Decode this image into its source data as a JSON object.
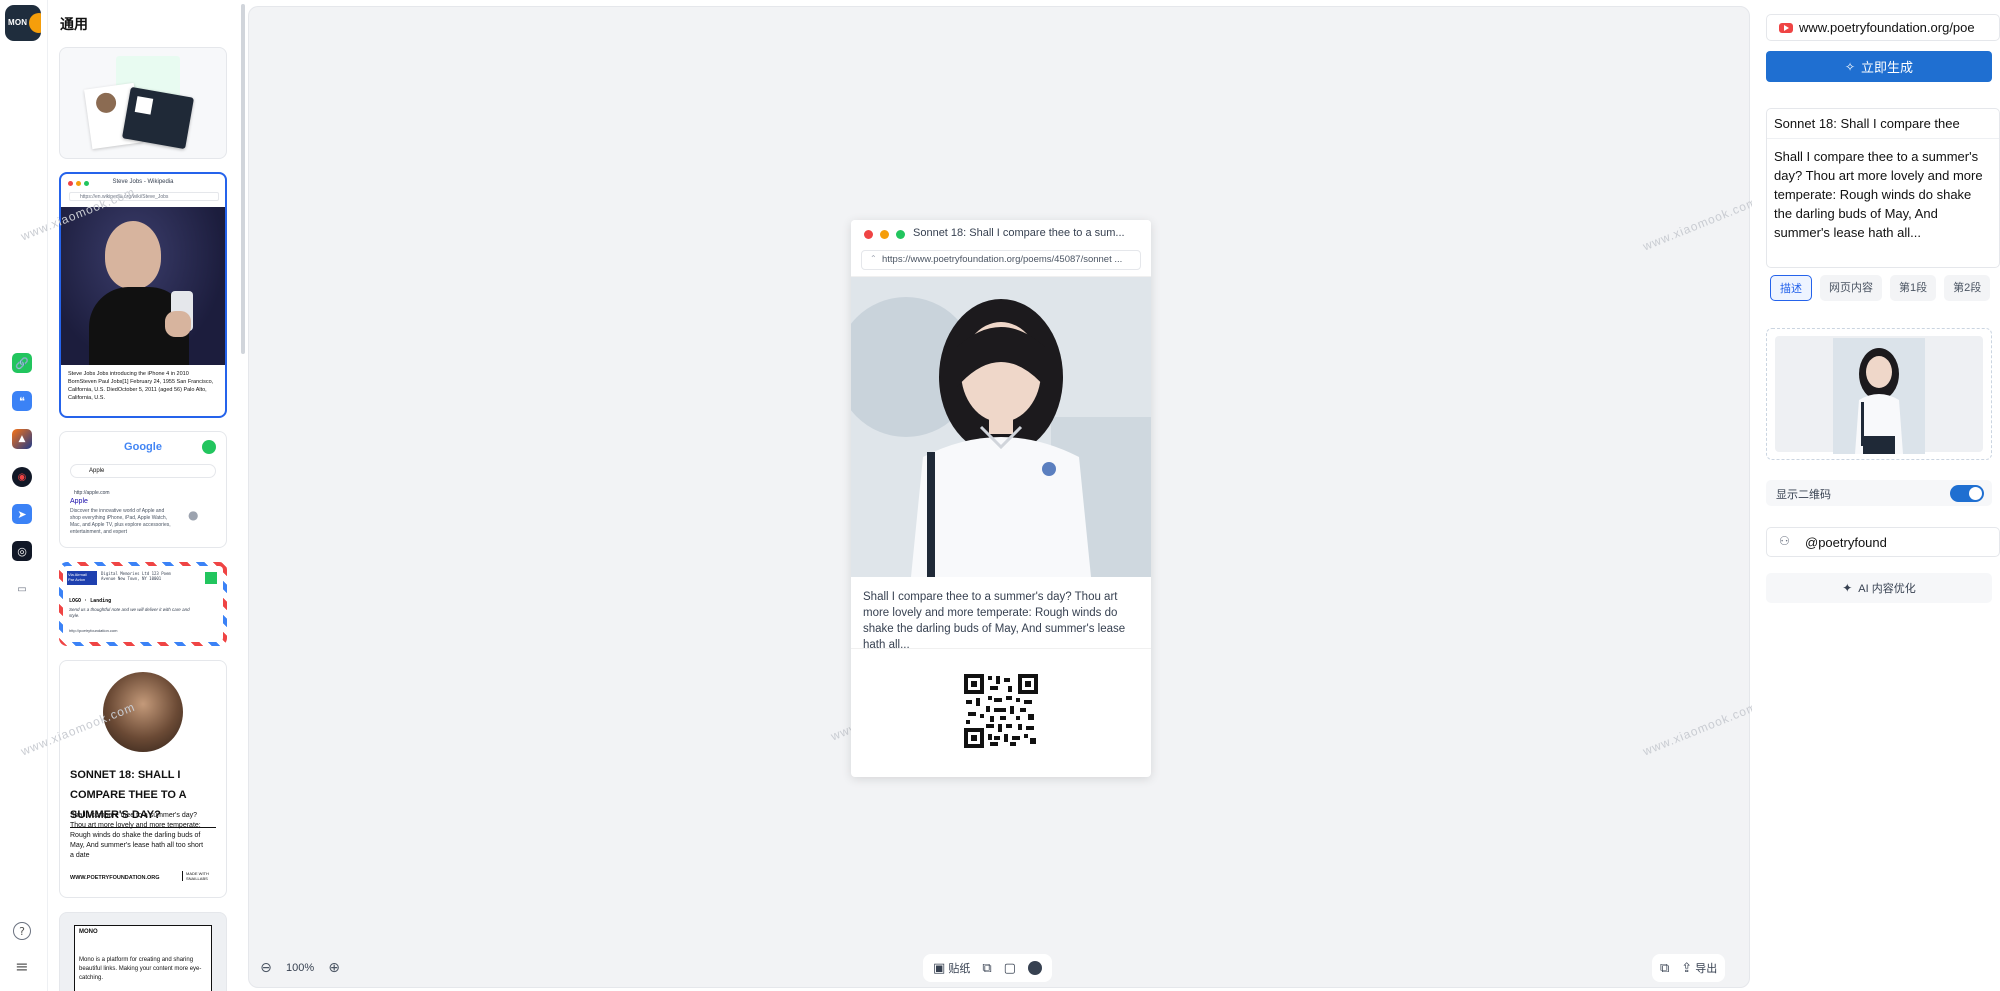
{
  "sidebar": {
    "logo_text": "MON",
    "icons": [
      {
        "name": "link-icon",
        "color": "#22c55e",
        "glyph": "🔗"
      },
      {
        "name": "quote-icon",
        "color": "#3b82f6",
        "glyph": "❝"
      },
      {
        "name": "image-icon",
        "color": "#ef4444",
        "glyph": "▲"
      },
      {
        "name": "record-icon",
        "color": "#111827",
        "glyph": "◉"
      },
      {
        "name": "telegram-icon",
        "color": "#3b82f6",
        "glyph": "➤"
      },
      {
        "name": "camera-icon",
        "color": "#111827",
        "glyph": "◎"
      },
      {
        "name": "toggle-icon",
        "color": "#6b7280",
        "glyph": "▭"
      }
    ],
    "help_glyph": "?",
    "menu_glyph": "≡"
  },
  "templates": {
    "title": "通用",
    "card2": {
      "window_title": "Steve Jobs - Wikipedia",
      "url": "https://en.wikipedia.org/wiki/Steve_Jobs",
      "caption": "Steve Jobs Jobs introducing the iPhone 4 in 2010 BornSteven Paul Jobs[1] February 24, 1955 San Francisco, California, U.S. DiedOctober 5, 2011 (aged 56) Palo Alto, California, U.S."
    },
    "card3": {
      "logo": "Google",
      "query": "Apple",
      "result_url": "http://apple.com",
      "result_title": "Apple",
      "result_desc": "Discover the innovative world of Apple and shop everything iPhone, iPad, Apple Watch, Mac, and Apple TV, plus explore accessories, entertainment, and expert"
    },
    "card4": {
      "tag1": "Via Airmail",
      "tag2": "Par Avion",
      "addr": "Digital Memories Ltd 123 Poem Avenue New Town, NY 10001",
      "heading": "LOGO · Landing",
      "body": "Send us a thoughtful note and we will deliver it with care and style.",
      "link": "http://poetryfoundation.com"
    },
    "card5": {
      "headline": "SONNET 18: SHALL I COMPARE THEE TO A SUMMER'S DAY?",
      "body": "Shall I compare thee to a summer's day? Thou art more lovely and more temperate: Rough winds do shake the darling buds of May, And summer's lease hath all too short a date",
      "site": "WWW.POETRYFOUNDATION.ORG",
      "badge": "MADE WITH SNAILLABS"
    },
    "card6": {
      "logo": "MONO",
      "body": "Mono is a platform for creating and sharing beautiful links. Making your content more eye-catching."
    }
  },
  "canvas": {
    "watermark": "www.xiaomook.com",
    "preview": {
      "title": "Sonnet 18: Shall I compare thee to a sum...",
      "url": "https://www.poetryfoundation.org/poems/45087/sonnet ...",
      "text": "Shall I compare thee to a summer's day? Thou art more lovely and more temperate: Rough winds do shake the darling buds of May, And summer's lease hath all..."
    },
    "zoom": "100%",
    "paste_label": "贴纸",
    "export_label": "导出"
  },
  "panel": {
    "url_value": "www.poetryfoundation.org/poe",
    "generate_label": "立即生成",
    "title_value": "Sonnet 18: Shall I compare thee",
    "body_value": "Shall I compare thee to a summer's day? Thou art more lovely and more temperate: Rough winds do shake the darling buds of May, And summer's lease hath all...",
    "tabs": [
      "描述",
      "网页内容",
      "第1段",
      "第2段"
    ],
    "qr_label": "显示二维码",
    "qr_enabled": true,
    "author_value": "@poetryfound",
    "ai_label": "AI 内容优化",
    "accent": "#1f6fd1"
  }
}
